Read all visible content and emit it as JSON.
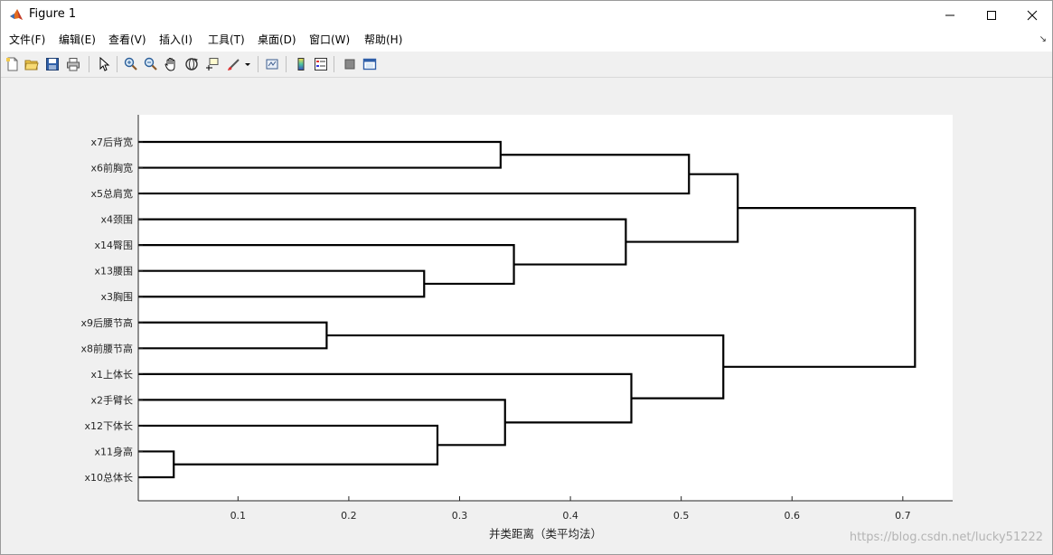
{
  "window": {
    "title": "Figure 1"
  },
  "menu": {
    "items": [
      "文件(F)",
      "编辑(E)",
      "查看(V)",
      "插入(I)",
      "工具(T)",
      "桌面(D)",
      "窗口(W)",
      "帮助(H)"
    ]
  },
  "toolbar": {
    "icons": [
      "new-figure-icon",
      "open-file-icon",
      "save-icon",
      "print-icon",
      "select-arrow-icon",
      "zoom-in-icon",
      "zoom-out-icon",
      "pan-hand-icon",
      "rotate-3d-icon",
      "data-cursor-icon",
      "brush-icon",
      "brush-dropdown-icon",
      "link-plot-icon",
      "colorbar-icon",
      "legend-icon",
      "hide-plot-tools-icon",
      "show-plot-tools-icon"
    ]
  },
  "colors": {
    "plot_background": "#ffffff",
    "figure_background": "#f0f0f0",
    "line": "#000000",
    "axis": "#262626"
  },
  "chart_data": {
    "type": "dendrogram",
    "orientation": "right",
    "xlabel": "并类距离（类平均法）",
    "ylabel": "",
    "title": "",
    "xlim": [
      0.01,
      0.745
    ],
    "xticks": [
      0.1,
      0.2,
      0.3,
      0.4,
      0.5,
      0.6,
      0.7
    ],
    "xtick_labels": [
      "0.1",
      "0.2",
      "0.3",
      "0.4",
      "0.5",
      "0.6",
      "0.7"
    ],
    "grid": false,
    "leaves": [
      "x7后背宽",
      "x6前胸宽",
      "x5总肩宽",
      "x4颈围",
      "x14臀围",
      "x13腰围",
      "x3胸围",
      "x9后腰节高",
      "x8前腰节高",
      "x1上体长",
      "x2手臂长",
      "x12下体长",
      "x11身高",
      "x10总体长"
    ],
    "merges": [
      {
        "id": "c1",
        "left": "x11身高",
        "right": "x10总体长",
        "height": 0.042
      },
      {
        "id": "c2",
        "left": "x9后腰节高",
        "right": "x8前腰节高",
        "height": 0.18
      },
      {
        "id": "c3",
        "left": "x13腰围",
        "right": "x3胸围",
        "height": 0.268
      },
      {
        "id": "c4",
        "left": "x12下体长",
        "right": "c1",
        "height": 0.28
      },
      {
        "id": "c5",
        "left": "x7后背宽",
        "right": "x6前胸宽",
        "height": 0.337
      },
      {
        "id": "c6",
        "left": "x2手臂长",
        "right": "c4",
        "height": 0.341
      },
      {
        "id": "c7",
        "left": "x14臀围",
        "right": "c3",
        "height": 0.349
      },
      {
        "id": "c8",
        "left": "x4颈围",
        "right": "c7",
        "height": 0.45
      },
      {
        "id": "c9",
        "left": "x1上体长",
        "right": "c6",
        "height": 0.455
      },
      {
        "id": "c10",
        "left": "c5",
        "right": "x5总肩宽",
        "height": 0.507
      },
      {
        "id": "c11",
        "left": "c2",
        "right": "c9",
        "height": 0.538
      },
      {
        "id": "c12",
        "left": "c10",
        "right": "c8",
        "height": 0.551
      },
      {
        "id": "c13",
        "left": "c12",
        "right": "c11",
        "height": 0.711
      }
    ]
  },
  "watermark": "https://blog.csdn.net/lucky51222"
}
